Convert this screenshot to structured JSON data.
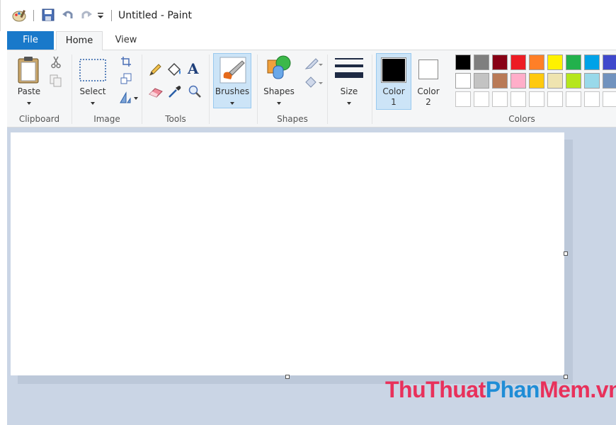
{
  "window": {
    "title": "Untitled - Paint"
  },
  "tabs": [
    {
      "label": "File"
    },
    {
      "label": "Home"
    },
    {
      "label": "View"
    }
  ],
  "ribbon": {
    "clipboard": {
      "label": "Clipboard",
      "paste_label": "Paste"
    },
    "image": {
      "label": "Image",
      "select_label": "Select"
    },
    "tools": {
      "label": "Tools"
    },
    "brushes": {
      "label": "Brushes"
    },
    "shapes": {
      "label": "Shapes",
      "shapes_label": "Shapes"
    },
    "size": {
      "label": "Size"
    },
    "color1": {
      "line1": "Color",
      "line2": "1",
      "value": "#000000"
    },
    "color2": {
      "line1": "Color",
      "line2": "2",
      "value": "#ffffff"
    },
    "colors": {
      "label": "Colors",
      "row1": [
        "#000000",
        "#7f7f7f",
        "#880015",
        "#ed1c24",
        "#ff7f27",
        "#fff200",
        "#22b14c",
        "#00a2e8",
        "#3f48cc"
      ],
      "row2": [
        "#ffffff",
        "#c3c3c3",
        "#b97a57",
        "#ffaec9",
        "#ffc90e",
        "#efe4b0",
        "#b5e61d",
        "#99d9ea",
        "#7092be"
      ]
    }
  },
  "icons": {
    "app": "paint-palette-icon",
    "save": "save-icon",
    "undo": "undo-icon",
    "redo": "redo-icon",
    "cut": "scissors-icon",
    "copy": "copy-icon",
    "crop": "crop-icon",
    "resize": "resize-icon",
    "rotate": "rotate-icon",
    "pencil": "pencil-icon",
    "fill": "fill-bucket-icon",
    "text": "text-icon",
    "eraser": "eraser-icon",
    "picker": "color-picker-icon",
    "magnifier": "magnifier-icon"
  },
  "watermark": {
    "part1": "ThuThuat",
    "part2": "Phan",
    "part3": "Mem.vn"
  }
}
